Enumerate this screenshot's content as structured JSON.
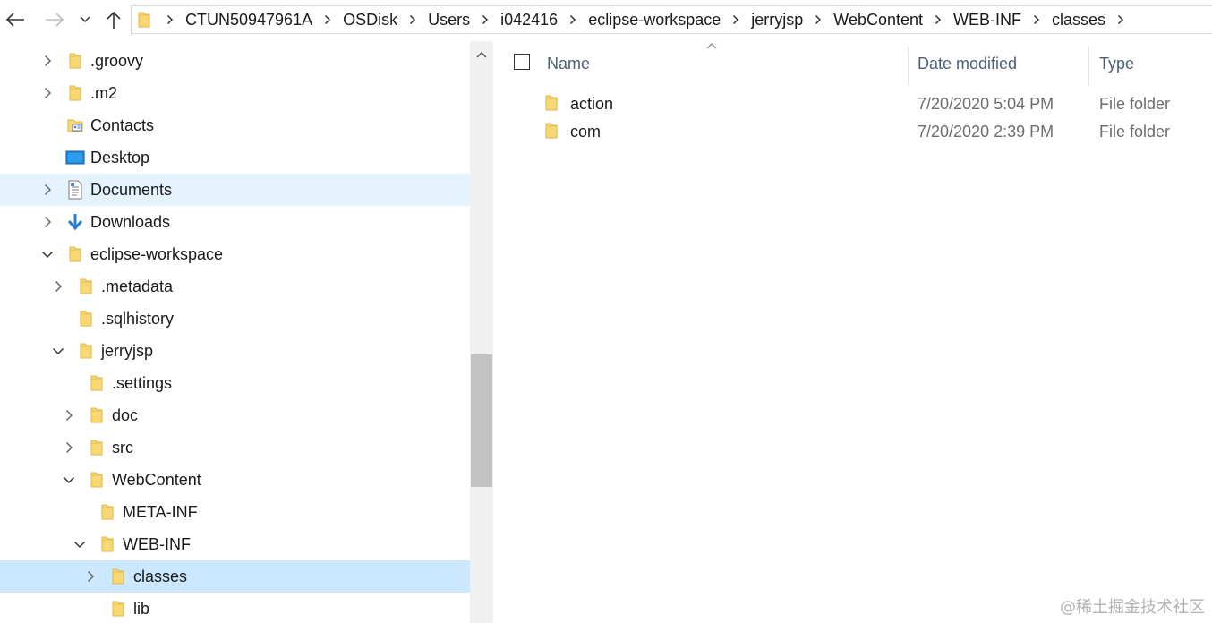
{
  "address": {
    "crumbs": [
      "CTUN50947961A",
      "OSDisk",
      "Users",
      "i042416",
      "eclipse-workspace",
      "jerryjsp",
      "WebContent",
      "WEB-INF",
      "classes"
    ]
  },
  "nav_tree": [
    {
      "label": ".groovy",
      "icon": "folder-icon",
      "chevron": "right",
      "selected": false
    },
    {
      "label": ".m2",
      "icon": "folder-icon",
      "chevron": "right",
      "selected": false
    },
    {
      "label": "Contacts",
      "icon": "contacts-icon",
      "chevron": "none",
      "selected": false
    },
    {
      "label": "Desktop",
      "icon": "desktop-icon",
      "chevron": "none",
      "selected": false
    },
    {
      "label": "Documents",
      "icon": "documents-icon",
      "chevron": "right",
      "selected": false,
      "hover": true
    },
    {
      "label": "Downloads",
      "icon": "downloads-icon",
      "chevron": "right",
      "selected": false
    },
    {
      "label": "eclipse-workspace",
      "icon": "folder-icon",
      "chevron": "down",
      "selected": false
    },
    {
      "label": ".metadata",
      "icon": "folder-icon",
      "chevron": "right",
      "selected": false
    },
    {
      "label": ".sqlhistory",
      "icon": "folder-icon",
      "chevron": "none",
      "selected": false
    },
    {
      "label": "jerryjsp",
      "icon": "folder-icon",
      "chevron": "down",
      "selected": false
    },
    {
      "label": ".settings",
      "icon": "folder-icon",
      "chevron": "none",
      "selected": false
    },
    {
      "label": "doc",
      "icon": "folder-icon",
      "chevron": "right",
      "selected": false
    },
    {
      "label": "src",
      "icon": "folder-icon",
      "chevron": "right",
      "selected": false
    },
    {
      "label": "WebContent",
      "icon": "folder-icon",
      "chevron": "down",
      "selected": false
    },
    {
      "label": "META-INF",
      "icon": "folder-icon",
      "chevron": "none",
      "selected": false
    },
    {
      "label": "WEB-INF",
      "icon": "folder-icon",
      "chevron": "down",
      "selected": false
    },
    {
      "label": "classes",
      "icon": "folder-icon",
      "chevron": "right",
      "selected": true
    },
    {
      "label": "lib",
      "icon": "folder-icon",
      "chevron": "none",
      "selected": false
    }
  ],
  "columns": {
    "name": "Name",
    "date_modified": "Date modified",
    "type": "Type"
  },
  "files": [
    {
      "name": "action",
      "date_modified": "7/20/2020 5:04 PM",
      "type": "File folder"
    },
    {
      "name": "com",
      "date_modified": "7/20/2020 2:39 PM",
      "type": "File folder"
    }
  ],
  "watermark": "@稀土掘金技术社区",
  "colors": {
    "selected_bg": "#cce8ff",
    "hover_bg": "#e5f3ff",
    "folder_yellow": "#f8d775",
    "header_text": "#4c607a"
  }
}
